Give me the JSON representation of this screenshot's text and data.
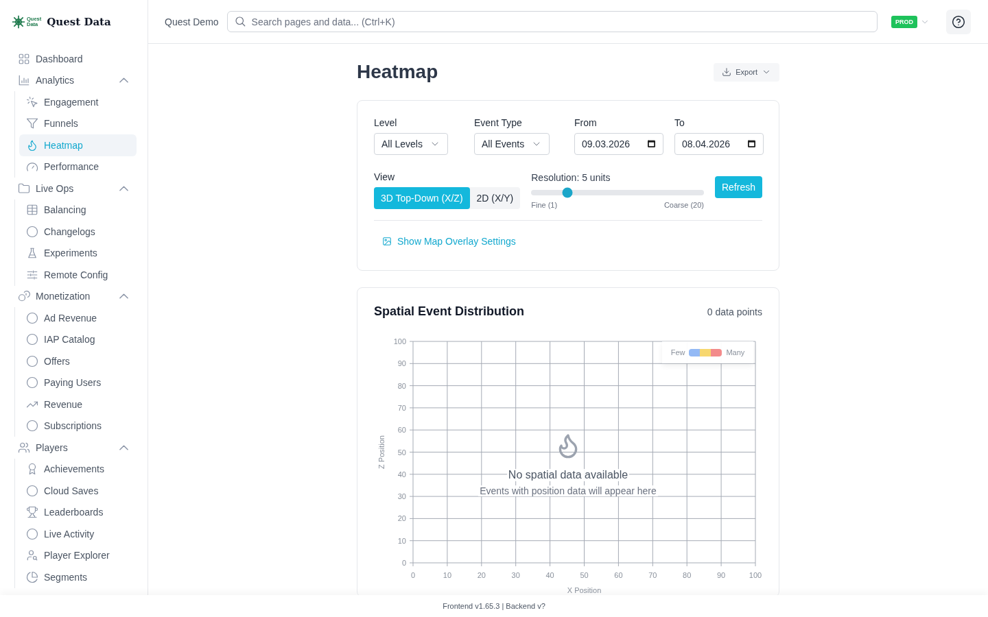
{
  "brand": {
    "mark_lines": [
      "Quest",
      "Data"
    ],
    "name": "Quest Data"
  },
  "sidebar": {
    "items": [
      {
        "label": "Dashboard",
        "selected": false
      },
      {
        "label": "Analytics",
        "selected": false,
        "expanded": true,
        "children": [
          {
            "label": "Engagement",
            "selected": false
          },
          {
            "label": "Funnels",
            "selected": false
          },
          {
            "label": "Heatmap",
            "selected": true
          },
          {
            "label": "Performance",
            "selected": false
          }
        ]
      },
      {
        "label": "Live Ops",
        "selected": false,
        "expanded": true,
        "children": [
          {
            "label": "Balancing",
            "selected": false
          },
          {
            "label": "Changelogs",
            "selected": false
          },
          {
            "label": "Experiments",
            "selected": false
          },
          {
            "label": "Remote Config",
            "selected": false
          }
        ]
      },
      {
        "label": "Monetization",
        "selected": false,
        "expanded": true,
        "children": [
          {
            "label": "Ad Revenue",
            "selected": false
          },
          {
            "label": "IAP Catalog",
            "selected": false
          },
          {
            "label": "Offers",
            "selected": false
          },
          {
            "label": "Paying Users",
            "selected": false
          },
          {
            "label": "Revenue",
            "selected": false
          },
          {
            "label": "Subscriptions",
            "selected": false
          }
        ]
      },
      {
        "label": "Players",
        "selected": false,
        "expanded": true,
        "children": [
          {
            "label": "Achievements",
            "selected": false
          },
          {
            "label": "Cloud Saves",
            "selected": false
          },
          {
            "label": "Leaderboards",
            "selected": false
          },
          {
            "label": "Live Activity",
            "selected": false
          },
          {
            "label": "Player Explorer",
            "selected": false
          },
          {
            "label": "Segments",
            "selected": false
          }
        ]
      }
    ]
  },
  "header": {
    "project": "Quest Demo",
    "search": {
      "placeholder": "Search pages and data... (Ctrl+K)"
    },
    "environment": "PROD"
  },
  "page": {
    "title": "Heatmap",
    "export_button": "Export"
  },
  "filters": {
    "fields": [
      {
        "kind": "select",
        "label": "Level",
        "value": "All Levels"
      },
      {
        "kind": "select",
        "label": "Event Type",
        "value": "All Events"
      },
      {
        "kind": "date",
        "label": "From",
        "value": "09.03.2026"
      },
      {
        "kind": "date",
        "label": "To",
        "value": "08.04.2026"
      }
    ],
    "view": {
      "label": "View",
      "options": [
        {
          "label": "3D Top-Down (X/Z)",
          "selected": true
        },
        {
          "label": "2D (X/Y)",
          "selected": false
        }
      ]
    },
    "resolution": {
      "label": "Resolution: 5 units",
      "level": 0.21,
      "min_label": "Fine (1)",
      "max_label": "Coarse (20)"
    },
    "refresh_button": "Refresh",
    "overlay_link": "Show Map Overlay Settings"
  },
  "distribution": {
    "title": "Spatial Event Distribution",
    "count": "0 data points",
    "legend": {
      "low": "Few",
      "high": "Many"
    },
    "empty_title": "No spatial data available",
    "empty_text": "Events with position data will appear here",
    "chart_data": {
      "type": "scatter",
      "grid": true,
      "xlabel": "X Position",
      "ylabel": "Z Position",
      "xlim": [
        0,
        100
      ],
      "ylim": [
        0,
        100
      ],
      "xticks": [
        0,
        10,
        20,
        30,
        40,
        50,
        60,
        70,
        80,
        90,
        100
      ],
      "yticks": [
        0,
        10,
        20,
        30,
        40,
        50,
        60,
        70,
        80,
        90,
        100
      ]
    }
  },
  "footer": "Frontend v1.65.3 | Backend v?"
}
